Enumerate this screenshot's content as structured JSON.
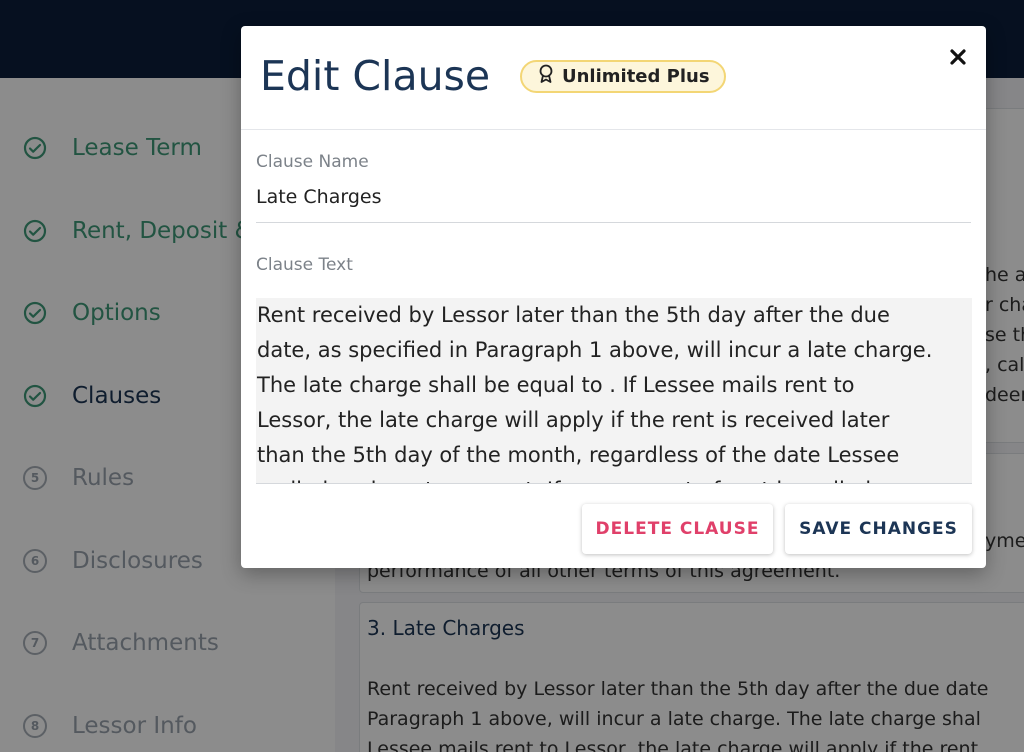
{
  "sidebar": {
    "items": [
      {
        "label": "Lease Term",
        "state": "done",
        "icon": "check-circle-icon"
      },
      {
        "label": "Rent, Deposit & Fees",
        "state": "done",
        "icon": "check-circle-icon"
      },
      {
        "label": "Options",
        "state": "done",
        "icon": "check-circle-icon"
      },
      {
        "label": "Clauses",
        "state": "current",
        "icon": "check-circle-icon"
      },
      {
        "label": "Rules",
        "state": "pending",
        "number": "5"
      },
      {
        "label": "Disclosures",
        "state": "pending",
        "number": "6"
      },
      {
        "label": "Attachments",
        "state": "pending",
        "number": "7"
      },
      {
        "label": "Lessor Info",
        "state": "pending",
        "number": "8"
      }
    ]
  },
  "background": {
    "right_fragments": [
      "he a",
      "r cha",
      "se th",
      ", calc",
      "deem"
    ],
    "mid_fragment": "ymen",
    "performance_line": "performance of all other terms of this agreement.",
    "clause3_title": "3. Late Charges",
    "clause3_lines": [
      "Rent received by Lessor later than the 5th day after the due date",
      "Paragraph 1 above, will incur a late charge. The late charge shal",
      "Lessee mails rent to Lessor, the late charge will apply if the rent"
    ]
  },
  "modal": {
    "title": "Edit Clause",
    "badge": {
      "label": "Unlimited Plus",
      "icon": "award-ribbon-icon",
      "color": "#f3d675"
    },
    "close_icon": "close-icon",
    "clause_name_label": "Clause Name",
    "clause_name_value": "Late Charges",
    "clause_text_label": "Clause Text",
    "clause_text_lines": [
      "Rent received by Lessor later than the 5th day after the due",
      "date, as specified in Paragraph 1 above, will incur a late charge.",
      "The late charge shall be equal to . If Lessee mails rent to",
      "Lessor, the late charge will apply if the rent is received later",
      "than the 5th day of the month, regardless of the date Lessee",
      "mailed such rent payment. If any amount of rent is mailed or"
    ],
    "delete_label": "DELETE CLAUSE",
    "save_label": "SAVE CHANGES"
  },
  "colors": {
    "navy": "#0b1e3b",
    "title": "#1c3555",
    "done_green": "#3f9a78",
    "delete_red": "#e0406a"
  }
}
